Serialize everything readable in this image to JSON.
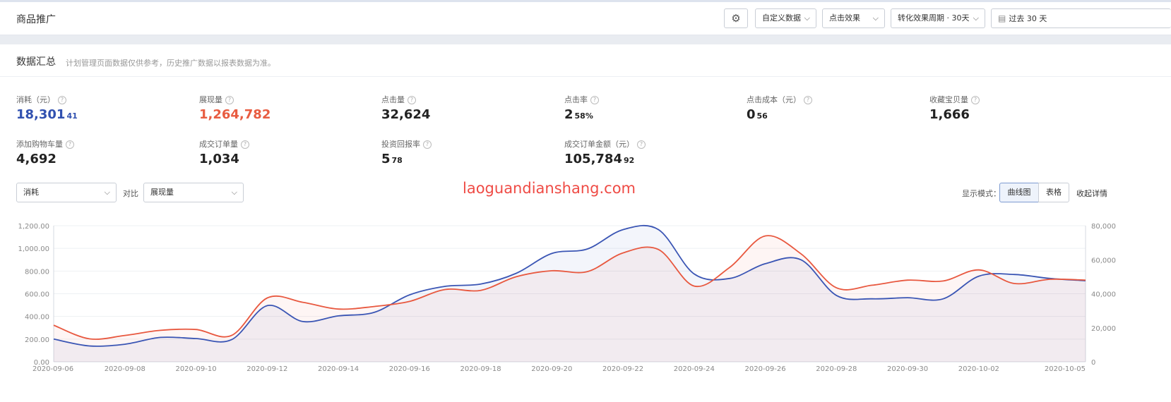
{
  "header": {
    "title": "商品推广",
    "dropdown_custom": "自定义数据",
    "dropdown_click": "点击效果",
    "dropdown_cycle": "转化效果周期 · 30天",
    "date_range": "过去 30 天"
  },
  "summary": {
    "title": "数据汇总",
    "note": "计划管理页面数据仅供参考，历史推广数据以报表数据为准。",
    "help_mark": "?",
    "metrics": [
      {
        "label": "消耗（元）",
        "int": "18,301",
        "dec": "41",
        "color": "#3151b0"
      },
      {
        "label": "展现量",
        "int": "1,264,782",
        "dec": "",
        "color": "#e85c41"
      },
      {
        "label": "点击量",
        "int": "32,624",
        "dec": "",
        "color": "#222222"
      },
      {
        "label": "点击率",
        "int": "2",
        "dec": "58%",
        "color": "#222222"
      },
      {
        "label": "点击成本（元）",
        "int": "0",
        "dec": "56",
        "color": "#222222"
      },
      {
        "label": "收藏宝贝量",
        "int": "1,666",
        "dec": "",
        "color": "#222222"
      },
      {
        "label": "添加购物车量",
        "int": "4,692",
        "dec": "",
        "color": "#222222"
      },
      {
        "label": "成交订单量",
        "int": "1,034",
        "dec": "",
        "color": "#222222"
      },
      {
        "label": "投资回报率",
        "int": "5",
        "dec": "78",
        "color": "#222222"
      },
      {
        "label": "成交订单金额（元）",
        "int": "105,784",
        "dec": "92",
        "color": "#222222"
      }
    ]
  },
  "controls": {
    "primary_metric": "消耗",
    "compare_label": "对比",
    "compare_metric": "展现量",
    "watermark": "laoguandianshang.com",
    "mode_label": "显示模式：",
    "mode_curve": "曲线图",
    "mode_table": "表格",
    "collapse": "收起详情"
  },
  "chart_data": {
    "type": "line",
    "x": [
      "2020-09-06",
      "2020-09-07",
      "2020-09-08",
      "2020-09-09",
      "2020-09-10",
      "2020-09-11",
      "2020-09-12",
      "2020-09-13",
      "2020-09-14",
      "2020-09-15",
      "2020-09-16",
      "2020-09-17",
      "2020-09-18",
      "2020-09-19",
      "2020-09-20",
      "2020-09-21",
      "2020-09-22",
      "2020-09-23",
      "2020-09-24",
      "2020-09-25",
      "2020-09-26",
      "2020-09-27",
      "2020-09-28",
      "2020-09-29",
      "2020-09-30",
      "2020-10-01",
      "2020-10-02",
      "2020-10-03",
      "2020-10-04",
      "2020-10-05"
    ],
    "x_tick_labels": [
      "2020-09-06",
      "2020-09-08",
      "2020-09-10",
      "2020-09-12",
      "2020-09-14",
      "2020-09-16",
      "2020-09-18",
      "2020-09-20",
      "2020-09-22",
      "2020-09-24",
      "2020-09-26",
      "2020-09-28",
      "2020-09-30",
      "2020-10-02",
      "2020-10-05"
    ],
    "y_left_ticks": [
      "0.00",
      "200.00",
      "400.00",
      "600.00",
      "800.00",
      "1,000.00",
      "1,200.00"
    ],
    "y_right_ticks": [
      "0",
      "20,000",
      "40,000",
      "60,000",
      "80,000"
    ],
    "y_left_range": [
      0,
      1200
    ],
    "y_right_range": [
      0,
      80000
    ],
    "series": [
      {
        "axis": "left",
        "color": "#3a55b4",
        "values": [
          200,
          140,
          155,
          215,
          205,
          195,
          495,
          355,
          405,
          435,
          590,
          665,
          685,
          780,
          955,
          995,
          1165,
          1165,
          775,
          735,
          865,
          900,
          585,
          555,
          565,
          555,
          755,
          770,
          735,
          715
        ]
      },
      {
        "axis": "right",
        "color": "#e8583f",
        "values": [
          21500,
          13500,
          15500,
          18500,
          19000,
          15500,
          37500,
          35000,
          31000,
          32500,
          35500,
          42500,
          42000,
          50000,
          53500,
          53000,
          64000,
          66000,
          44500,
          55500,
          74000,
          63500,
          43500,
          45000,
          48000,
          47500,
          54000,
          46000,
          48500,
          48000
        ]
      }
    ]
  }
}
